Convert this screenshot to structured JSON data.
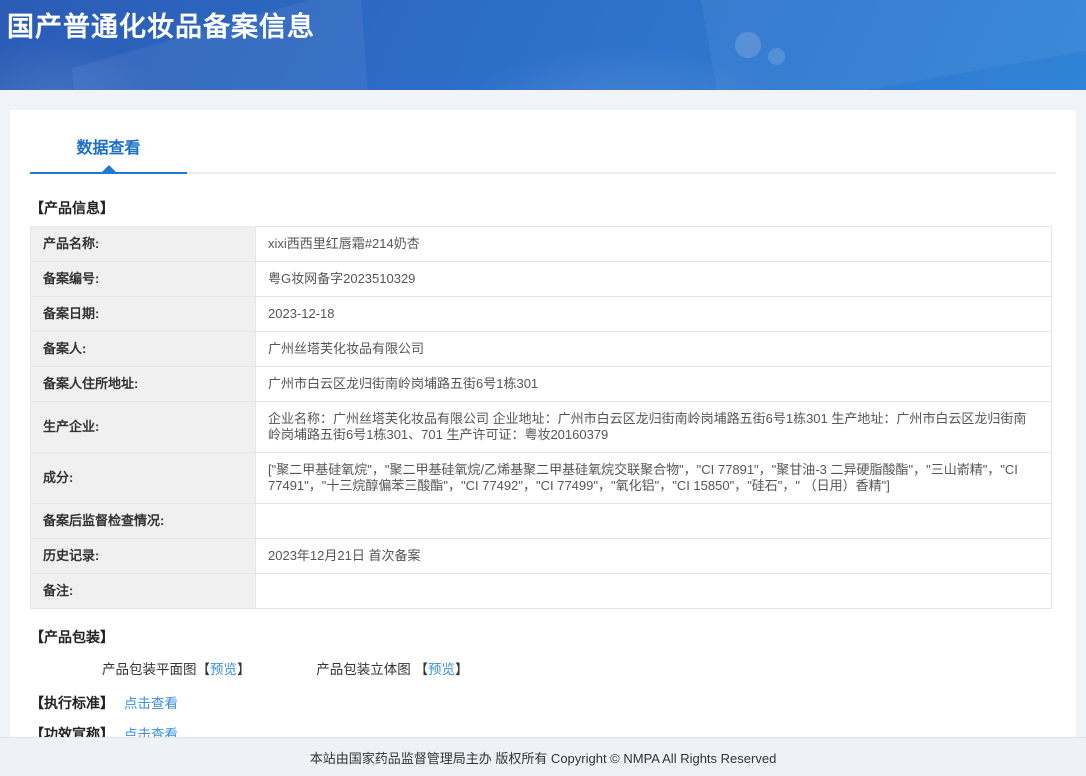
{
  "header": {
    "title": "国产普通化妆品备案信息"
  },
  "tabs": {
    "data_view": "数据查看"
  },
  "product_info": {
    "section_title": "【产品信息】",
    "rows": [
      {
        "label": "产品名称:",
        "value": "xixi西西里红唇霜#214奶杏"
      },
      {
        "label": "备案编号:",
        "value": "粤G妆网备字2023510329"
      },
      {
        "label": "备案日期:",
        "value": "2023-12-18"
      },
      {
        "label": "备案人:",
        "value": "广州丝塔芙化妆品有限公司"
      },
      {
        "label": "备案人住所地址:",
        "value": "广州市白云区龙归街南岭岗埔路五街6号1栋301"
      },
      {
        "label": "生产企业:",
        "value": "企业名称：广州丝塔芙化妆品有限公司 企业地址：广州市白云区龙归街南岭岗埔路五街6号1栋301 生产地址：广州市白云区龙归街南岭岗埔路五街6号1栋301、701 生产许可证：粤妆20160379"
      },
      {
        "label": "成分:",
        "value": "[\"聚二甲基硅氧烷\"，\"聚二甲基硅氧烷/乙烯基聚二甲基硅氧烷交联聚合物\"，\"CI 77891\"，\"聚甘油-3 二异硬脂酸酯\"，\"三山嵛精\"，\"CI 77491\"，\"十三烷醇偏苯三酸酯\"，\"CI 77492\"，\"CI 77499\"，\"氧化铝\"，\"CI 15850\"，\"硅石\"，\" （日用）香精\"]"
      },
      {
        "label": "备案后监督检查情况:",
        "value": ""
      },
      {
        "label": "历史记录:",
        "value": "2023年12月21日 首次备案"
      },
      {
        "label": "备注:",
        "value": ""
      }
    ]
  },
  "packaging": {
    "section_title": "【产品包装】",
    "flat_label": "产品包装平面图",
    "stereo_label": "产品包装立体图",
    "bracket_open": "【",
    "bracket_close": "】",
    "preview_link": "预览"
  },
  "standard": {
    "section_title": "【执行标准】",
    "link": "点击查看"
  },
  "efficacy": {
    "section_title": "【功效宣称】",
    "link": "点击查看"
  },
  "footer": {
    "text": "本站由国家药品监督管理局主办 版权所有 Copyright © NMPA All Rights Reserved"
  },
  "colors": {
    "header_gradient_start": "#2b5cb5",
    "header_gradient_end": "#3083d6",
    "tab_blue": "#1a6fc7",
    "underline_blue": "#1d79d2",
    "link_blue": "#3a8ee4",
    "table_border_blue": "#a9c4e4",
    "label_cell_bg": "#f0f0f0",
    "footer_bg": "#eef1f5"
  }
}
